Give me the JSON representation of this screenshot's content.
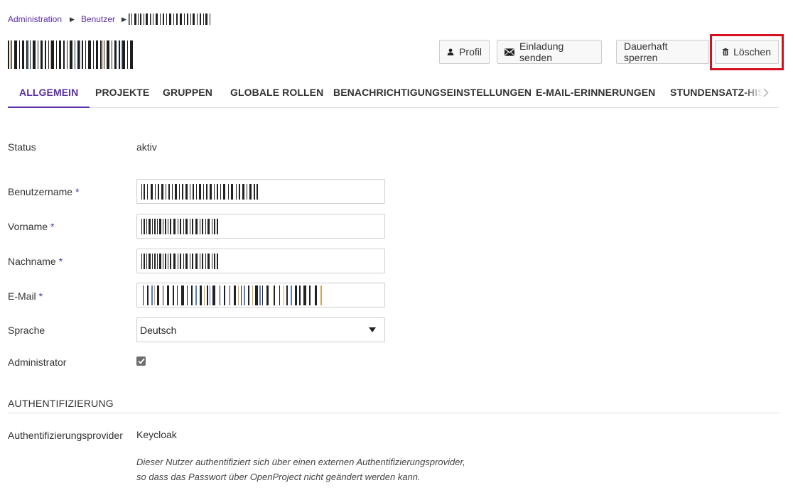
{
  "breadcrumb": {
    "items": [
      "Administration",
      "Benutzer"
    ],
    "separator": "▶"
  },
  "toolbar": {
    "profile_label": "Profil",
    "invite_label": "Einladung senden",
    "lock_label": "Dauerhaft sperren",
    "delete_label": "Löschen"
  },
  "tabs": [
    "ALLGEMEIN",
    "PROJEKTE",
    "GRUPPEN",
    "GLOBALE ROLLEN",
    "BENACHRICHTIGUNGSEINSTELLUNGEN",
    "E-MAIL-ERINNERUNGEN",
    "STUNDENSATZ-HIS"
  ],
  "form": {
    "status_label": "Status",
    "status_value": "aktiv",
    "username_label": "Benutzername",
    "firstname_label": "Vorname",
    "lastname_label": "Nachname",
    "email_label": "E-Mail",
    "required_mark": "*",
    "language_label": "Sprache",
    "language_value": "Deutsch",
    "admin_label": "Administrator",
    "admin_checked": true
  },
  "auth": {
    "section_title": "AUTHENTIFIZIERUNG",
    "provider_label": "Authentifizierungsprovider",
    "provider_value": "Keycloak",
    "note_line1": "Dieser Nutzer authentifiziert sich über einen externen Authentifizierungsprovider,",
    "note_line2": "so dass das Passwort über OpenProject nicht geändert werden kann."
  },
  "colors": {
    "accent": "#5b2fa8",
    "highlight": "#d6101e",
    "border": "#cfcfcf"
  },
  "icons": [
    "user-icon",
    "envelope-icon",
    "trash-icon",
    "chevron-right-icon",
    "dropdown-caret-icon",
    "check-icon"
  ]
}
